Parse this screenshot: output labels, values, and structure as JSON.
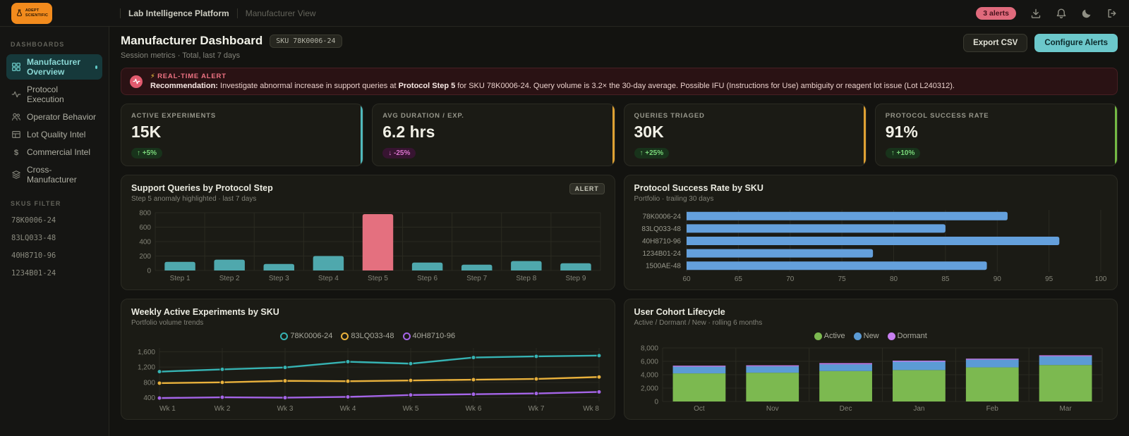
{
  "brand": {
    "logo_line1": "ADEPT",
    "logo_line2": "SCIENTIFIC"
  },
  "topbar": {
    "app_title": "Lab Intelligence Platform",
    "view_title": "Manufacturer View",
    "alerts_badge": "3 alerts"
  },
  "sidebar": {
    "dashboards_label": "DASHBOARDS",
    "items": [
      {
        "label": "Manufacturer Overview",
        "icon": "grid",
        "active": true
      },
      {
        "label": "Protocol Execution",
        "icon": "pulse",
        "active": false
      },
      {
        "label": "Operator Behavior",
        "icon": "users",
        "active": false
      },
      {
        "label": "Lot Quality Intel",
        "icon": "table",
        "active": false
      },
      {
        "label": "Commercial Intel",
        "icon": "dollar",
        "active": false
      },
      {
        "label": "Cross-Manufacturer",
        "icon": "layers",
        "active": false
      }
    ],
    "skus_label": "SKUS FILTER",
    "skus": [
      "78K0006-24",
      "83LQ033-48",
      "40H8710-96",
      "1234B01-24"
    ]
  },
  "header": {
    "title": "Manufacturer Dashboard",
    "sku_badge": "SKU 78K0006-24",
    "subtitle": "Session metrics · Total, last 7 days",
    "export_label": "Export CSV",
    "configure_label": "Configure Alerts"
  },
  "alert": {
    "bolt": "⚡",
    "title": "REAL-TIME ALERT",
    "rec_label": "Recommendation:",
    "seg1": " Investigate abnormal increase in support queries at ",
    "bold_step": "Protocol Step 5",
    "seg2": " for SKU 78K0006-24. Query volume is 3.2× the 30-day average. Possible IFU (Instructions for Use) ambiguity or reagent lot issue (Lot L240312)."
  },
  "kpis": [
    {
      "label": "ACTIVE EXPERIMENTS",
      "value": "15K",
      "delta": "↑ +5%",
      "delta_kind": "up",
      "accent": "#4fb8bd"
    },
    {
      "label": "AVG DURATION / EXP.",
      "value": "6.2 hrs",
      "delta": "↓ -25%",
      "delta_kind": "down",
      "accent": "#dfa133"
    },
    {
      "label": "QUERIES TRIAGED",
      "value": "30K",
      "delta": "↑ +25%",
      "delta_kind": "up",
      "accent": "#dfa133"
    },
    {
      "label": "PROTOCOL SUCCESS RATE",
      "value": "91%",
      "delta": "↑ +10%",
      "delta_kind": "up",
      "accent": "#74b944"
    }
  ],
  "chart_data": [
    {
      "type": "bar",
      "title": "Support Queries by Protocol Step",
      "subtitle": "Step 5 anomaly highlighted · last 7 days",
      "badge": "ALERT",
      "categories": [
        "Step 1",
        "Step 2",
        "Step 3",
        "Step 4",
        "Step 5",
        "Step 6",
        "Step 7",
        "Step 8",
        "Step 9"
      ],
      "values": [
        120,
        150,
        90,
        200,
        780,
        110,
        80,
        130,
        100
      ],
      "highlight_index": 4,
      "bar_color": "#4fa8ad",
      "highlight_color": "#e4707f",
      "ylim": [
        0,
        800
      ],
      "yticks": [
        0,
        200,
        400,
        600,
        800
      ],
      "ytick_labels": [
        "0",
        "200",
        "400",
        "600",
        "800"
      ],
      "grid": true
    },
    {
      "type": "hbar",
      "title": "Protocol Success Rate by SKU",
      "subtitle": "Portfolio · trailing 30 days",
      "categories": [
        "78K0006-24",
        "83LQ033-48",
        "40H8710-96",
        "1234B01-24",
        "1500AE-48"
      ],
      "values": [
        91,
        85,
        96,
        78,
        89
      ],
      "bar_color": "#64a0dc",
      "xlim": [
        60,
        100
      ],
      "xticks": [
        60,
        65,
        70,
        75,
        80,
        85,
        90,
        95,
        100
      ],
      "grid": true
    },
    {
      "type": "line",
      "title": "Weekly Active Experiments by SKU",
      "subtitle": "Portfolio volume trends",
      "x": [
        "Wk 1",
        "Wk 2",
        "Wk 3",
        "Wk 4",
        "Wk 5",
        "Wk 6",
        "Wk 7",
        "Wk 8"
      ],
      "series": [
        {
          "name": "78K0006-24",
          "color": "#36b3b3",
          "values": [
            1080,
            1140,
            1190,
            1340,
            1290,
            1450,
            1480,
            1500
          ]
        },
        {
          "name": "83LQ033-48",
          "color": "#e9b13c",
          "values": [
            780,
            800,
            840,
            830,
            850,
            870,
            890,
            940
          ]
        },
        {
          "name": "40H8710-96",
          "color": "#a565e8",
          "values": [
            390,
            410,
            400,
            420,
            470,
            490,
            510,
            550
          ]
        }
      ],
      "ylim": [
        300,
        1700
      ],
      "yticks": [
        400,
        800,
        1200,
        1600
      ],
      "ytick_labels": [
        "400",
        "800",
        "1,200",
        "1,600"
      ],
      "legend_position": "top-center",
      "grid": true
    },
    {
      "type": "stacked",
      "title": "User Cohort Lifecycle",
      "subtitle": "Active / Dormant / New · rolling 6 months",
      "categories": [
        "Oct",
        "Nov",
        "Dec",
        "Jan",
        "Feb",
        "Mar"
      ],
      "series": [
        {
          "name": "Active",
          "color": "#7cb950",
          "values": [
            4200,
            4300,
            4550,
            4700,
            5100,
            5450
          ]
        },
        {
          "name": "New",
          "color": "#5b9bd5",
          "values": [
            1000,
            950,
            1000,
            1250,
            1150,
            1300
          ]
        },
        {
          "name": "Dormant",
          "color": "#c77ff0",
          "values": [
            150,
            150,
            180,
            150,
            150,
            150
          ]
        }
      ],
      "ylim": [
        0,
        8000
      ],
      "yticks": [
        0,
        2000,
        4000,
        6000,
        8000
      ],
      "ytick_labels": [
        "0",
        "2,000",
        "4,000",
        "6,000",
        "8,000"
      ],
      "legend_position": "top-center",
      "grid": true
    }
  ]
}
